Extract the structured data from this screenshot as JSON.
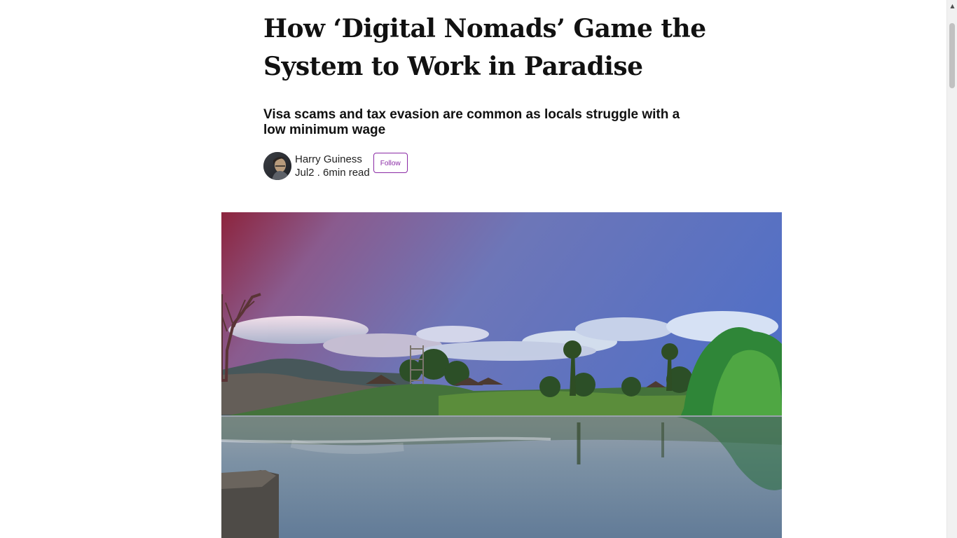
{
  "article": {
    "title": "How ‘Digital Nomads’ Game the System to Work in Paradise",
    "subtitle": "Visa scams and tax evasion are common as locals struggle with a low minimum wage",
    "author": {
      "name": "Harry Guiness",
      "meta": "Jul2 . 6min read",
      "follow_label": "Follow"
    }
  },
  "scrollbar": {
    "up_icon": "▲",
    "thumb_position_fraction": 0.04
  },
  "colors": {
    "follow_accent": "#8a2aa5",
    "text": "#111111"
  }
}
